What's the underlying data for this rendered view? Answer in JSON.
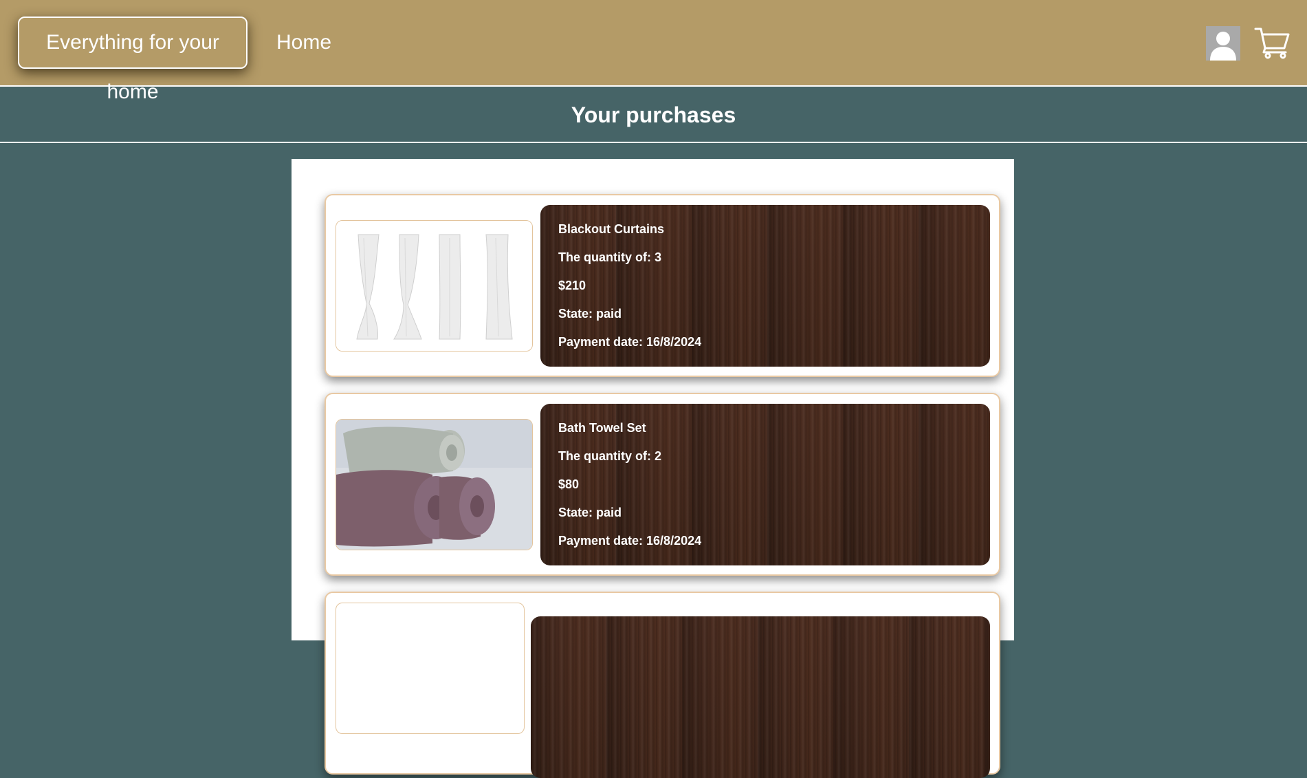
{
  "navbar": {
    "brand": "Everything for your home",
    "home_label": "Home",
    "icons": [
      "user-avatar-icon",
      "shopping-cart-icon"
    ]
  },
  "page": {
    "title": "Your purchases"
  },
  "purchases": [
    {
      "name": "Blackout Curtains",
      "quantity_label": "The quantity of: 3",
      "price": "$210",
      "state_label": "State: paid",
      "payment_label": "Payment date: 16/8/2024",
      "image": "white-curtains-image"
    },
    {
      "name": "Bath Towel Set",
      "quantity_label": "The quantity of: 2",
      "price": "$80",
      "state_label": "State: paid",
      "payment_label": "Payment date: 16/8/2024",
      "image": "rolled-towels-image"
    }
  ],
  "colors": {
    "navbar": "#b49b67",
    "background": "#466467",
    "card_border": "#e9c9a3",
    "info_panel": "#3d2419"
  }
}
